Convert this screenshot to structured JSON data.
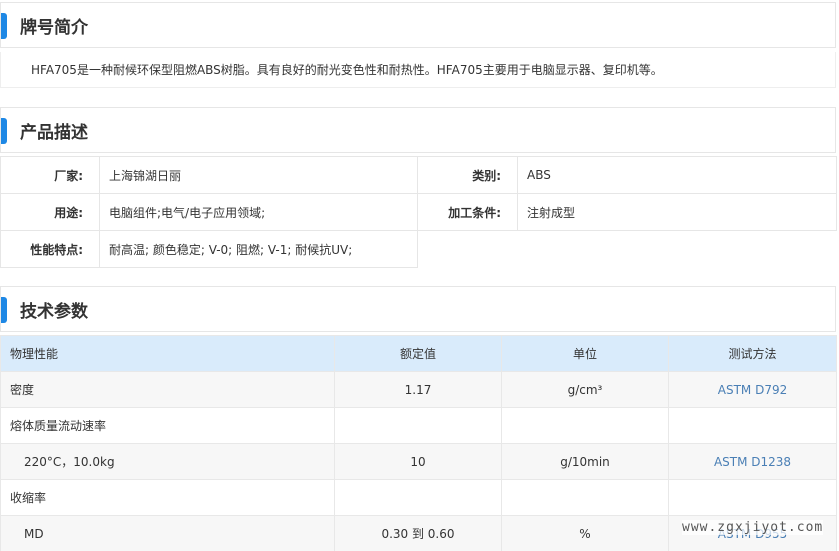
{
  "brand_intro": {
    "title": "牌号简介",
    "text": "HFA705是一种耐候环保型阻燃ABS树脂。具有良好的耐光变色性和耐热性。HFA705主要用于电脑显示器、复印机等。"
  },
  "product_desc": {
    "title": "产品描述",
    "rows": [
      {
        "k1": "厂家:",
        "v1": "上海锦湖日丽",
        "k2": "类别:",
        "v2": "ABS"
      },
      {
        "k1": "用途:",
        "v1": "电脑组件;电气/电子应用领域;",
        "k2": "加工条件:",
        "v2": "注射成型"
      },
      {
        "k1": "性能特点:",
        "v1": "耐高温; 颜色稳定; V-0; 阻燃; V-1; 耐候抗UV;",
        "k2": "",
        "v2": ""
      }
    ]
  },
  "tech_params": {
    "title": "技术参数",
    "headers": [
      "物理性能",
      "额定值",
      "单位",
      "测试方法"
    ],
    "rows": [
      [
        "密度",
        "1.17",
        "g/cm³",
        "ASTM D792"
      ],
      [
        "熔体质量流动速率",
        "",
        "",
        ""
      ],
      [
        "220°C，10.0kg",
        "10",
        "g/10min",
        "ASTM D1238"
      ],
      [
        "收缩率",
        "",
        "",
        ""
      ],
      [
        "MD",
        "0.30 到 0.60",
        "%",
        "ASTM D955"
      ]
    ]
  },
  "watermark": "www.zgxjiyot.com"
}
